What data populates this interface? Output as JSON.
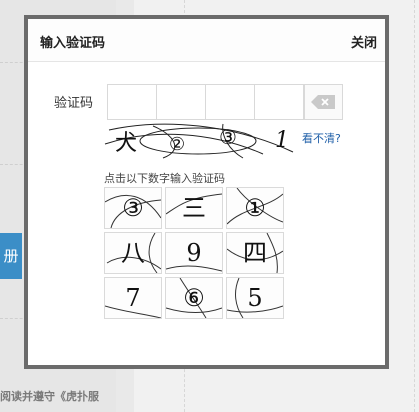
{
  "background": {
    "button_label": "册",
    "footer_text": "阅读并遵守《虎扑服"
  },
  "modal": {
    "title": "输入验证码",
    "close_label": "关闭",
    "field_label": "验证码",
    "refresh_link": "看不清?",
    "instruction": "点击以下数字输入验证码",
    "captcha_chars": [
      "犬",
      "②",
      "③",
      "1"
    ],
    "tiles": [
      {
        "text": "③"
      },
      {
        "text": "三"
      },
      {
        "text": "①"
      },
      {
        "text": "八"
      },
      {
        "text": "9"
      },
      {
        "text": "四"
      },
      {
        "text": "7"
      },
      {
        "text": "⑥"
      },
      {
        "text": "5"
      }
    ]
  },
  "icons": {
    "clear": "clear-input-icon"
  }
}
